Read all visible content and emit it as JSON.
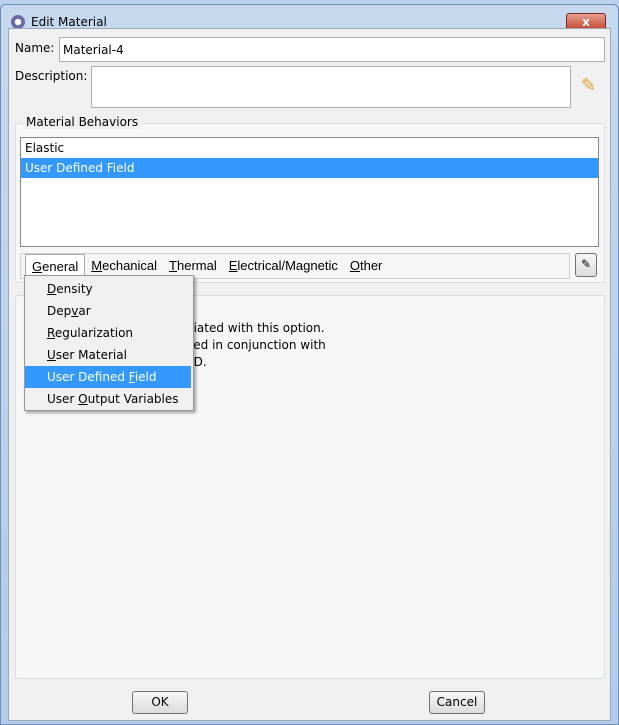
{
  "window": {
    "title": "Edit Material",
    "close_label": "x"
  },
  "name": {
    "label": "Name:",
    "value": "Material-4"
  },
  "description": {
    "label": "Description:",
    "value": ""
  },
  "behaviors": {
    "label": "Material Behaviors",
    "items": [
      {
        "label": "Elastic",
        "selected": false
      },
      {
        "label": "User Defined Field",
        "selected": true
      }
    ]
  },
  "menubar": {
    "items": [
      "General",
      "Mechanical",
      "Thermal",
      "Electrical/Magnetic",
      "Other"
    ]
  },
  "general_menu": {
    "items": [
      "Density",
      "Depvar",
      "Regularization",
      "User Material",
      "User Defined Field",
      "User Output Variables"
    ],
    "highlighted": "User Defined Field"
  },
  "info_text": {
    "line1": "ciated with this option.",
    "line2": "sed in conjunction with",
    "line3": "LD."
  },
  "buttons": {
    "ok": "OK",
    "cancel": "Cancel"
  },
  "colors": {
    "selection": "#3399ff",
    "close_button": "#c4422b"
  }
}
